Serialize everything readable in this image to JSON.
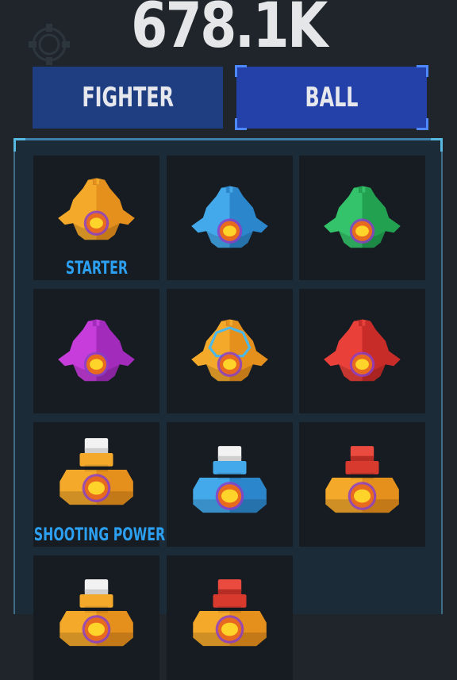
{
  "header": {
    "score": "678.1K",
    "settings_icon": "gear-icon"
  },
  "tabs": [
    {
      "label": "FIGHTER",
      "selected": false
    },
    {
      "label": "BALL",
      "selected": true
    }
  ],
  "grid": {
    "items": [
      {
        "type": "fighter",
        "colors": [
          "#f4a92b",
          "#e58f1c"
        ],
        "label": "STARTER"
      },
      {
        "type": "fighter",
        "colors": [
          "#44a9ea",
          "#2c86cc"
        ],
        "label": ""
      },
      {
        "type": "fighter",
        "colors": [
          "#34c36a",
          "#22a251"
        ],
        "label": ""
      },
      {
        "type": "fighter",
        "colors": [
          "#c63ddb",
          "#a22bbb"
        ],
        "label": ""
      },
      {
        "type": "fighter-outlined",
        "colors": [
          "#f4a92b",
          "#e58f1c"
        ],
        "label": ""
      },
      {
        "type": "fighter",
        "colors": [
          "#e9403a",
          "#c82c28"
        ],
        "label": ""
      },
      {
        "type": "cannon",
        "colors": [
          "#f4a92b",
          "#e58f1c"
        ],
        "label": "SHOOTING POWER"
      },
      {
        "type": "cannon",
        "colors": [
          "#44a9ea",
          "#2c86cc"
        ],
        "label": ""
      },
      {
        "type": "cannon-red",
        "colors": [
          "#f4a92b",
          "#e58f1c"
        ],
        "label": ""
      },
      {
        "type": "cannon-partial",
        "colors": [
          "#f4a92b",
          "#e58f1c"
        ],
        "label": ""
      },
      {
        "type": "cannon-partial-red",
        "colors": [
          "#f4a92b",
          "#e58f1c"
        ],
        "label": ""
      }
    ]
  }
}
